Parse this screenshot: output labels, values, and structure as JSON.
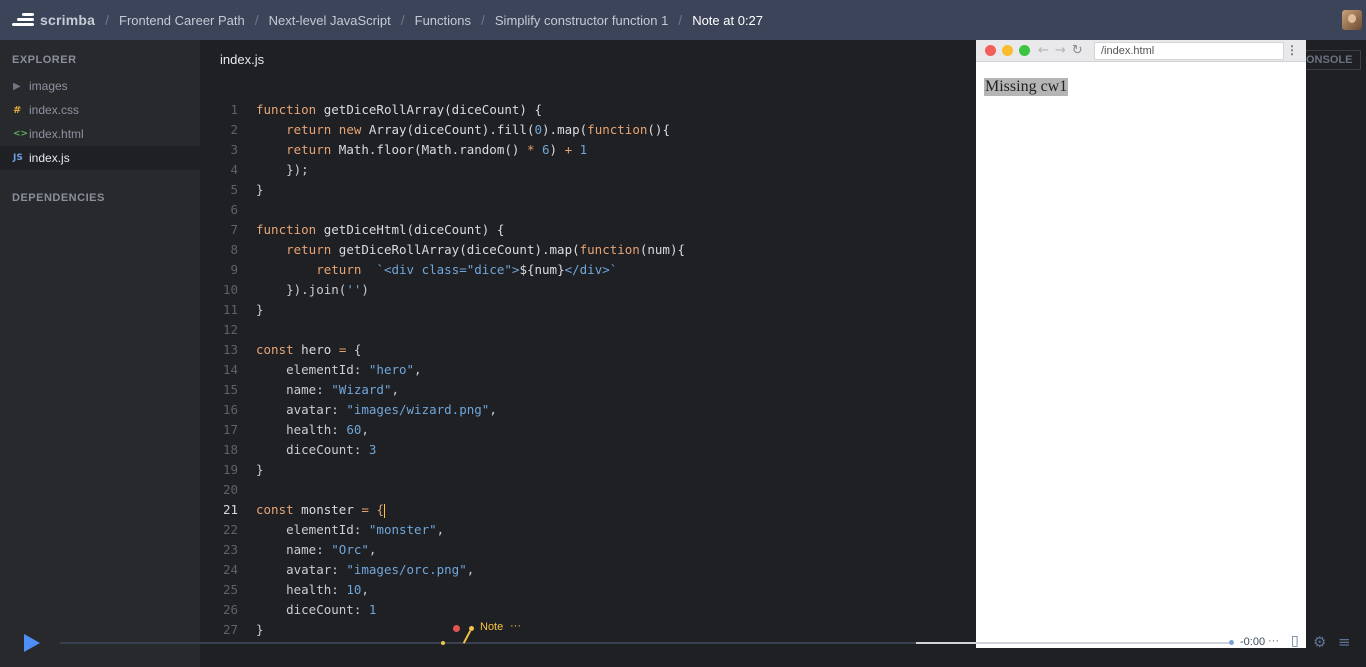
{
  "topbar": {
    "logo_text": "scrimba",
    "breadcrumbs": [
      "Frontend Career Path",
      "Next-level JavaScript",
      "Functions",
      "Simplify constructor function 1",
      "Note at 0:27"
    ]
  },
  "sidebar": {
    "explorer_heading": "EXPLORER",
    "dependencies_heading": "DEPENDENCIES",
    "items": [
      {
        "icon": "▶",
        "label": "images"
      },
      {
        "icon": "#",
        "label": "index.css"
      },
      {
        "icon": "<>",
        "label": "index.html"
      },
      {
        "icon": "JS",
        "label": "index.js"
      }
    ]
  },
  "editor": {
    "file_title": "index.js",
    "current_line": 21
  },
  "browser": {
    "url": "/index.html",
    "preview_text": "Missing cw1",
    "console_tab": "ONSOLE"
  },
  "player": {
    "time": "-0:00",
    "note_label": "Note",
    "note_more": "···",
    "time_more": "···"
  },
  "colors": {
    "topbar": "#3b4458",
    "sidebar": "#27292d",
    "editor_bg": "#1f2023",
    "keyword": "#e6a476",
    "string": "#70a6da",
    "accent_play": "#4d8ff7",
    "note_yellow": "#f3c346"
  }
}
